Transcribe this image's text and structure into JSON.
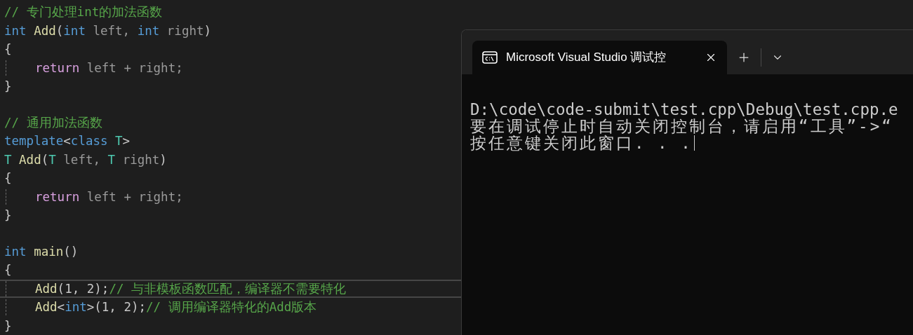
{
  "editor": {
    "lines": [
      {
        "kind": "code",
        "indent": false,
        "highlighted": false,
        "tokens": [
          {
            "kind": "comment",
            "text": "// 专门处理int的加法函数"
          }
        ]
      },
      {
        "kind": "code",
        "indent": false,
        "highlighted": false,
        "tokens": [
          {
            "kind": "keyword",
            "text": "int"
          },
          {
            "kind": "function",
            "text": " Add"
          },
          {
            "kind": "punct",
            "text": "("
          },
          {
            "kind": "keyword",
            "text": "int"
          },
          {
            "kind": "param",
            "text": " left, "
          },
          {
            "kind": "keyword",
            "text": "int"
          },
          {
            "kind": "param",
            "text": " right"
          },
          {
            "kind": "punct",
            "text": ")"
          }
        ]
      },
      {
        "kind": "code",
        "indent": false,
        "highlighted": false,
        "tokens": [
          {
            "kind": "punct",
            "text": "{"
          }
        ]
      },
      {
        "kind": "code",
        "indent": true,
        "highlighted": false,
        "tokens": [
          {
            "kind": "control",
            "text": "return"
          },
          {
            "kind": "param",
            "text": " left + right;"
          }
        ]
      },
      {
        "kind": "code",
        "indent": false,
        "highlighted": false,
        "tokens": [
          {
            "kind": "punct",
            "text": "}"
          }
        ]
      },
      {
        "kind": "blank"
      },
      {
        "kind": "code",
        "indent": false,
        "highlighted": false,
        "tokens": [
          {
            "kind": "comment",
            "text": "// 通用加法函数"
          }
        ]
      },
      {
        "kind": "code",
        "indent": false,
        "highlighted": false,
        "tokens": [
          {
            "kind": "keyword",
            "text": "template"
          },
          {
            "kind": "punct",
            "text": "<"
          },
          {
            "kind": "keyword",
            "text": "class"
          },
          {
            "kind": "type",
            "text": " T"
          },
          {
            "kind": "punct",
            "text": ">"
          }
        ]
      },
      {
        "kind": "code",
        "indent": false,
        "highlighted": false,
        "tokens": [
          {
            "kind": "type",
            "text": "T"
          },
          {
            "kind": "function",
            "text": " Add"
          },
          {
            "kind": "punct",
            "text": "("
          },
          {
            "kind": "type",
            "text": "T"
          },
          {
            "kind": "param",
            "text": " left, "
          },
          {
            "kind": "type",
            "text": "T"
          },
          {
            "kind": "param",
            "text": " right"
          },
          {
            "kind": "punct",
            "text": ")"
          }
        ]
      },
      {
        "kind": "code",
        "indent": false,
        "highlighted": false,
        "tokens": [
          {
            "kind": "punct",
            "text": "{"
          }
        ]
      },
      {
        "kind": "code",
        "indent": true,
        "highlighted": false,
        "tokens": [
          {
            "kind": "control",
            "text": "return"
          },
          {
            "kind": "param",
            "text": " left + right;"
          }
        ]
      },
      {
        "kind": "code",
        "indent": false,
        "highlighted": false,
        "tokens": [
          {
            "kind": "punct",
            "text": "}"
          }
        ]
      },
      {
        "kind": "blank"
      },
      {
        "kind": "code",
        "indent": false,
        "highlighted": false,
        "tokens": [
          {
            "kind": "keyword",
            "text": "int"
          },
          {
            "kind": "function",
            "text": " main"
          },
          {
            "kind": "punct",
            "text": "()"
          }
        ]
      },
      {
        "kind": "code",
        "indent": false,
        "highlighted": false,
        "tokens": [
          {
            "kind": "punct",
            "text": "{"
          }
        ]
      },
      {
        "kind": "code",
        "indent": true,
        "highlighted": true,
        "tokens": [
          {
            "kind": "function",
            "text": "Add"
          },
          {
            "kind": "punct",
            "text": "(1, 2);"
          },
          {
            "kind": "comment",
            "text": "// 与非模板函数匹配，编译器不需要特化"
          }
        ]
      },
      {
        "kind": "code",
        "indent": true,
        "highlighted": false,
        "tokens": [
          {
            "kind": "function",
            "text": "Add"
          },
          {
            "kind": "punct",
            "text": "<"
          },
          {
            "kind": "keyword",
            "text": "int"
          },
          {
            "kind": "punct",
            "text": ">(1, 2);"
          },
          {
            "kind": "comment",
            "text": "// 调用编译器特化的Add版本"
          }
        ]
      },
      {
        "kind": "code",
        "indent": false,
        "highlighted": false,
        "tokens": [
          {
            "kind": "punct",
            "text": "}"
          }
        ]
      }
    ]
  },
  "terminal": {
    "tab": {
      "title": "Microsoft Visual Studio 调试控",
      "selected": true
    },
    "lines": [
      "D:\\code\\code-submit\\test.cpp\\Debug\\test.cpp.e",
      "要在调试停止时自动关闭控制台，请启用“工具”->“",
      "按任意键关闭此窗口. . ."
    ]
  }
}
